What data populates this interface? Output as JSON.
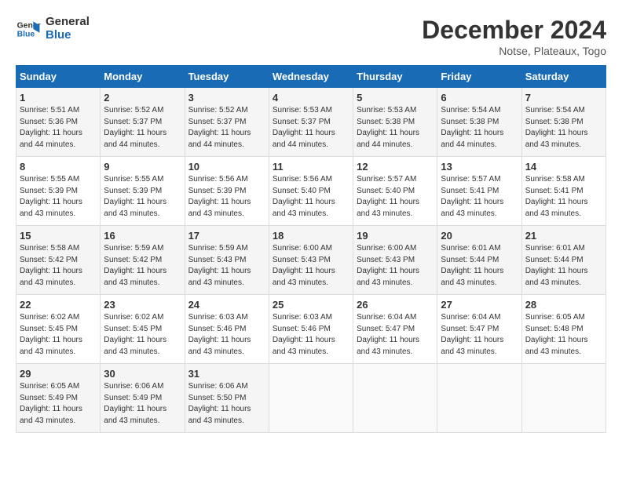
{
  "logo": {
    "line1": "General",
    "line2": "Blue"
  },
  "title": "December 2024",
  "subtitle": "Notse, Plateaux, Togo",
  "days_header": [
    "Sunday",
    "Monday",
    "Tuesday",
    "Wednesday",
    "Thursday",
    "Friday",
    "Saturday"
  ],
  "weeks": [
    [
      {
        "num": "1",
        "sunrise": "5:51 AM",
        "sunset": "5:36 PM",
        "daylight": "11 hours and 44 minutes."
      },
      {
        "num": "2",
        "sunrise": "5:52 AM",
        "sunset": "5:37 PM",
        "daylight": "11 hours and 44 minutes."
      },
      {
        "num": "3",
        "sunrise": "5:52 AM",
        "sunset": "5:37 PM",
        "daylight": "11 hours and 44 minutes."
      },
      {
        "num": "4",
        "sunrise": "5:53 AM",
        "sunset": "5:37 PM",
        "daylight": "11 hours and 44 minutes."
      },
      {
        "num": "5",
        "sunrise": "5:53 AM",
        "sunset": "5:38 PM",
        "daylight": "11 hours and 44 minutes."
      },
      {
        "num": "6",
        "sunrise": "5:54 AM",
        "sunset": "5:38 PM",
        "daylight": "11 hours and 44 minutes."
      },
      {
        "num": "7",
        "sunrise": "5:54 AM",
        "sunset": "5:38 PM",
        "daylight": "11 hours and 43 minutes."
      }
    ],
    [
      {
        "num": "8",
        "sunrise": "5:55 AM",
        "sunset": "5:39 PM",
        "daylight": "11 hours and 43 minutes."
      },
      {
        "num": "9",
        "sunrise": "5:55 AM",
        "sunset": "5:39 PM",
        "daylight": "11 hours and 43 minutes."
      },
      {
        "num": "10",
        "sunrise": "5:56 AM",
        "sunset": "5:39 PM",
        "daylight": "11 hours and 43 minutes."
      },
      {
        "num": "11",
        "sunrise": "5:56 AM",
        "sunset": "5:40 PM",
        "daylight": "11 hours and 43 minutes."
      },
      {
        "num": "12",
        "sunrise": "5:57 AM",
        "sunset": "5:40 PM",
        "daylight": "11 hours and 43 minutes."
      },
      {
        "num": "13",
        "sunrise": "5:57 AM",
        "sunset": "5:41 PM",
        "daylight": "11 hours and 43 minutes."
      },
      {
        "num": "14",
        "sunrise": "5:58 AM",
        "sunset": "5:41 PM",
        "daylight": "11 hours and 43 minutes."
      }
    ],
    [
      {
        "num": "15",
        "sunrise": "5:58 AM",
        "sunset": "5:42 PM",
        "daylight": "11 hours and 43 minutes."
      },
      {
        "num": "16",
        "sunrise": "5:59 AM",
        "sunset": "5:42 PM",
        "daylight": "11 hours and 43 minutes."
      },
      {
        "num": "17",
        "sunrise": "5:59 AM",
        "sunset": "5:43 PM",
        "daylight": "11 hours and 43 minutes."
      },
      {
        "num": "18",
        "sunrise": "6:00 AM",
        "sunset": "5:43 PM",
        "daylight": "11 hours and 43 minutes."
      },
      {
        "num": "19",
        "sunrise": "6:00 AM",
        "sunset": "5:43 PM",
        "daylight": "11 hours and 43 minutes."
      },
      {
        "num": "20",
        "sunrise": "6:01 AM",
        "sunset": "5:44 PM",
        "daylight": "11 hours and 43 minutes."
      },
      {
        "num": "21",
        "sunrise": "6:01 AM",
        "sunset": "5:44 PM",
        "daylight": "11 hours and 43 minutes."
      }
    ],
    [
      {
        "num": "22",
        "sunrise": "6:02 AM",
        "sunset": "5:45 PM",
        "daylight": "11 hours and 43 minutes."
      },
      {
        "num": "23",
        "sunrise": "6:02 AM",
        "sunset": "5:45 PM",
        "daylight": "11 hours and 43 minutes."
      },
      {
        "num": "24",
        "sunrise": "6:03 AM",
        "sunset": "5:46 PM",
        "daylight": "11 hours and 43 minutes."
      },
      {
        "num": "25",
        "sunrise": "6:03 AM",
        "sunset": "5:46 PM",
        "daylight": "11 hours and 43 minutes."
      },
      {
        "num": "26",
        "sunrise": "6:04 AM",
        "sunset": "5:47 PM",
        "daylight": "11 hours and 43 minutes."
      },
      {
        "num": "27",
        "sunrise": "6:04 AM",
        "sunset": "5:47 PM",
        "daylight": "11 hours and 43 minutes."
      },
      {
        "num": "28",
        "sunrise": "6:05 AM",
        "sunset": "5:48 PM",
        "daylight": "11 hours and 43 minutes."
      }
    ],
    [
      {
        "num": "29",
        "sunrise": "6:05 AM",
        "sunset": "5:49 PM",
        "daylight": "11 hours and 43 minutes."
      },
      {
        "num": "30",
        "sunrise": "6:06 AM",
        "sunset": "5:49 PM",
        "daylight": "11 hours and 43 minutes."
      },
      {
        "num": "31",
        "sunrise": "6:06 AM",
        "sunset": "5:50 PM",
        "daylight": "11 hours and 43 minutes."
      },
      null,
      null,
      null,
      null
    ]
  ]
}
